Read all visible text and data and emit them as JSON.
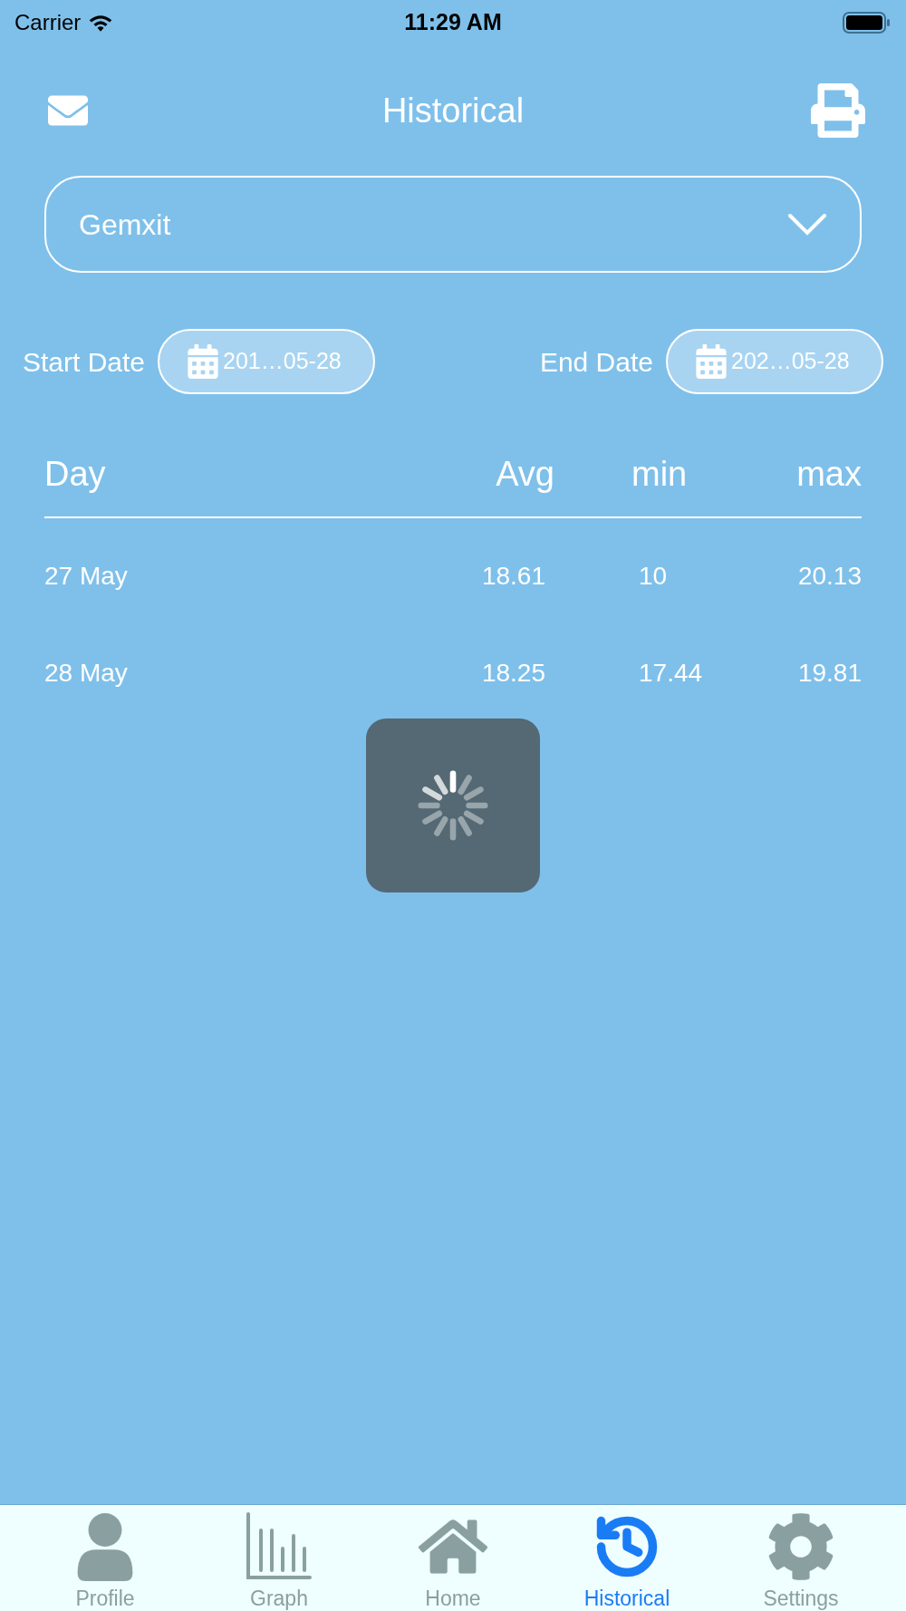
{
  "status_bar": {
    "carrier": "Carrier",
    "time": "11:29 AM"
  },
  "header": {
    "title": "Historical"
  },
  "device_select": {
    "value": "Gemxit"
  },
  "date_range": [
    {
      "label": "Start Date",
      "value": "201…05-28"
    },
    {
      "label": "End Date",
      "value": "202…05-28"
    }
  ],
  "table": {
    "columns": [
      "Day",
      "Avg",
      "min",
      "max"
    ],
    "rows": [
      [
        "27 May",
        "18.61",
        "10",
        "20.13"
      ],
      [
        "28 May",
        "18.25",
        "17.44",
        "19.81"
      ]
    ]
  },
  "loading": true,
  "tabs": [
    {
      "label": "Profile",
      "selected": false
    },
    {
      "label": "Graph",
      "selected": false
    },
    {
      "label": "Home",
      "selected": false
    },
    {
      "label": "Historical",
      "selected": true
    },
    {
      "label": "Settings",
      "selected": false
    }
  ]
}
